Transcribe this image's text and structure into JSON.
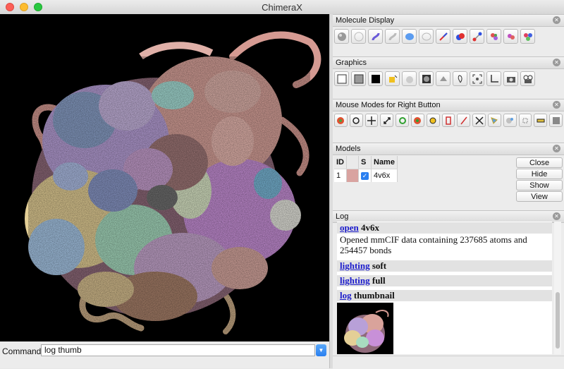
{
  "window": {
    "title": "ChimeraX"
  },
  "command": {
    "label": "Command:",
    "value": "log thumb"
  },
  "panels": {
    "molecule_display": {
      "title": "Molecule Display",
      "tools": [
        "atoms-icon",
        "hide-atoms-icon",
        "cartoon-icon",
        "hide-cartoon-icon",
        "surface-icon",
        "hide-surface-icon",
        "stick-icon",
        "sphere-icon",
        "ball-and-stick-icon",
        "color-by-chain-icon",
        "color-by-polymer-icon",
        "rainbow-icon"
      ]
    },
    "graphics": {
      "title": "Graphics",
      "tools": [
        "white-background-icon",
        "gray-background-icon",
        "black-background-icon",
        "simple-lighting-icon",
        "soft-lighting-icon",
        "full-lighting-icon",
        "flat-lighting-icon",
        "silhouette-icon",
        "view-all-icon",
        "orient-icon",
        "snapshot-icon",
        "spin-movie-icon"
      ]
    },
    "mouse_modes": {
      "title": "Mouse Modes for Right Button",
      "tools": [
        "select-icon",
        "rotate-icon",
        "translate-icon",
        "zoom-icon",
        "translate-selected-icon",
        "rotate-selected-icon",
        "pivot-icon",
        "distance-icon",
        "label-icon",
        "move-label-icon",
        "swapaa-icon",
        "tug-icon",
        "zone-icon",
        "clip-icon"
      ]
    },
    "models": {
      "title": "Models",
      "columns": [
        "ID",
        "",
        "S",
        "Name"
      ],
      "rows": [
        {
          "id": "1",
          "color": "#d9a3a0",
          "shown": true,
          "name": "4v6x"
        }
      ],
      "buttons": [
        "Close",
        "Hide",
        "Show",
        "View"
      ]
    },
    "log": {
      "title": "Log",
      "entries": [
        {
          "cmd": "open",
          "arg": "4v6x",
          "output": "Opened mmCIF data containing 237685 atoms and 254457 bonds"
        },
        {
          "cmd": "lighting",
          "arg": "soft",
          "output": ""
        },
        {
          "cmd": "lighting",
          "arg": "full",
          "output": ""
        },
        {
          "cmd": "log",
          "arg": "thumbnail",
          "output": ""
        }
      ]
    }
  },
  "colors": {
    "accent": "#2a7ff0",
    "link": "#1a1acc",
    "viewer_bg": "#000000"
  }
}
